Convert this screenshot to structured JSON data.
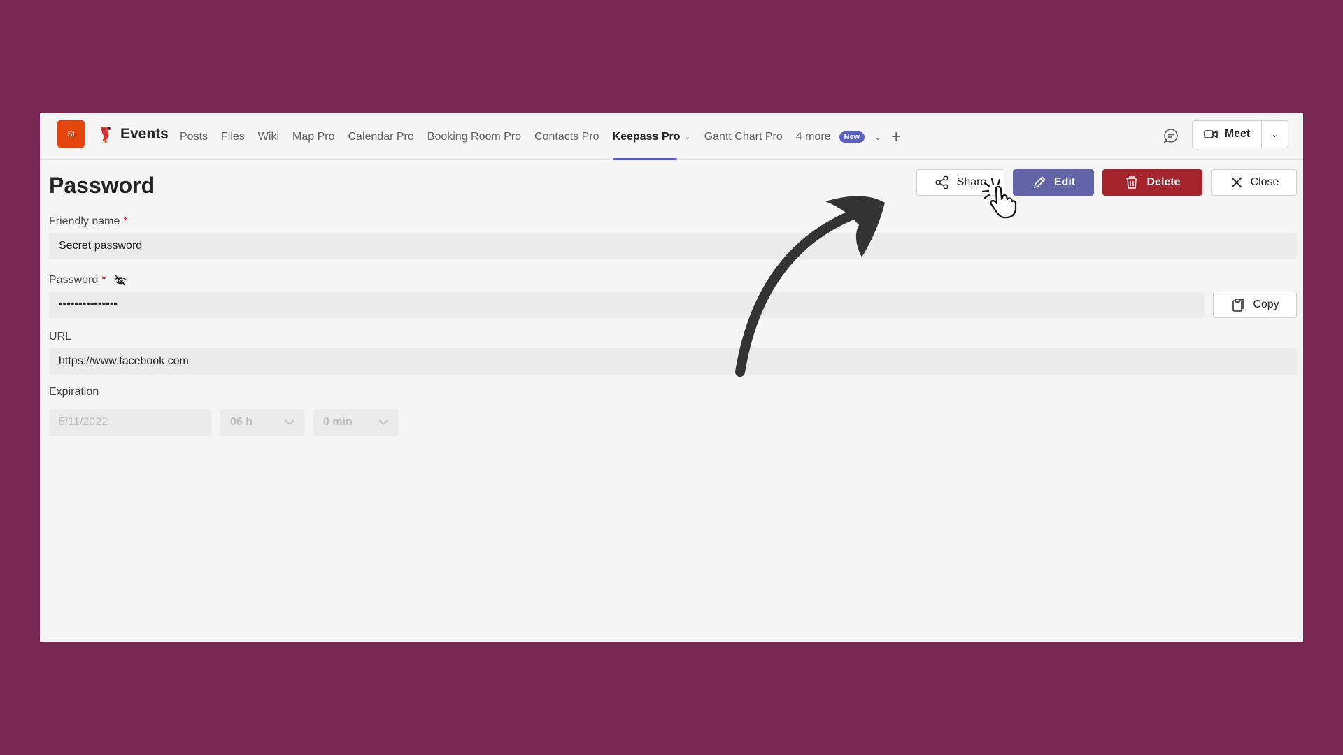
{
  "header": {
    "team_avatar": "St",
    "team_name": "Events",
    "tabs": [
      {
        "label": "Posts"
      },
      {
        "label": "Files"
      },
      {
        "label": "Wiki"
      },
      {
        "label": "Map Pro"
      },
      {
        "label": "Calendar Pro"
      },
      {
        "label": "Booking Room Pro"
      },
      {
        "label": "Contacts Pro"
      },
      {
        "label": "Keepass Pro",
        "active": true
      },
      {
        "label": "Gantt Chart Pro"
      }
    ],
    "more_label": "4 more",
    "new_badge": "New",
    "meet_label": "Meet"
  },
  "page": {
    "title": "Password",
    "actions": {
      "share": "Share",
      "edit": "Edit",
      "delete": "Delete",
      "close": "Close"
    },
    "fields": {
      "friendly_name_label": "Friendly name",
      "friendly_name_value": "Secret password",
      "password_label": "Password",
      "password_value": "•••••••••••••••",
      "copy_label": "Copy",
      "url_label": "URL",
      "url_value": "https://www.facebook.com",
      "expiration_label": "Expiration",
      "expiration_date": "5/11/2022",
      "expiration_hour": "06 h",
      "expiration_min": "0 min"
    },
    "required_marker": "*"
  },
  "colors": {
    "background": "#772752",
    "accent": "#5b5fc7",
    "edit": "#6264a7",
    "delete": "#a4262c",
    "team_avatar": "#e2460c"
  }
}
